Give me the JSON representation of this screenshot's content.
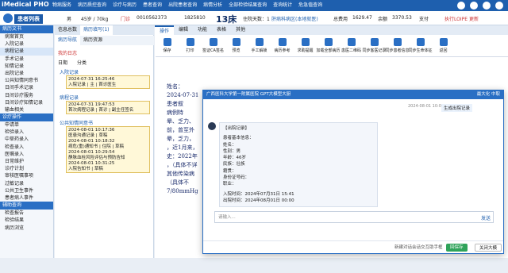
{
  "app": {
    "logo": "iMedical PHO",
    "menu": [
      "物病服务",
      "病历质控查询",
      "诊疗与病历",
      "患者查询",
      "出院患者查询",
      "病情分析",
      "全部检验结果查询",
      "查询统计",
      "危急值查询"
    ]
  },
  "patient": {
    "tag": "患者列表",
    "gender": "男",
    "age_weight": "45岁 / 70kg",
    "flag": "门诊",
    "id": "0010562373",
    "no": "1825810",
    "bed": "13床",
    "days": "住院天数：1",
    "ward": "肝病科病区(本地就医)",
    "cost_label": "总费用",
    "cost": "1629.47",
    "balance_label": "余额",
    "balance": "3370.53",
    "pay": "支付",
    "alert": "执行LOIPE 更新"
  },
  "left": {
    "sections": [
      {
        "title": "病历文书",
        "items": [
          "病案首页",
          "入院记录",
          "病程记录",
          "手术记录",
          "知情记录",
          "出院记录",
          "公共知情同意书",
          "日间手术记录",
          "日间诊疗服务",
          "日间诊疗知情记录",
          "输血相关"
        ]
      },
      {
        "title": "诊疗操作",
        "items": [
          "申请单",
          "检验录入",
          "中草药录入",
          "检查录入",
          "医嘱录入",
          "日常维护",
          "诊疗计划",
          "审核医嘱事项",
          "过敏记录",
          "公共卫生事件",
          "患者病人事件"
        ]
      },
      {
        "title": "辅助查询",
        "items": [
          "检查报告",
          "检验结果",
          "病历浏览"
        ]
      }
    ]
  },
  "tree": {
    "tabs": [
      "信息总数",
      "病历填写(1)"
    ],
    "subtabs": [
      "病历导航",
      "病历资源"
    ],
    "filter": "我的日志",
    "filter2": "日期",
    "filter3": "分类",
    "groups": [
      {
        "title": "入院记录",
        "items": [
          "2024-07-31 16:25:46",
          "入院记录 | 主 | 首诊医生"
        ]
      },
      {
        "title": "病程记录",
        "items": [
          "2024-07-31 19:47:53",
          "首次病程记录 | 首诊 | 副主任签名"
        ]
      },
      {
        "title": "公共知情同意书",
        "items": [
          "2024-08-01 10:17:36",
          "医患沟通记录 | 草稿",
          "2024-08-01 10:18:32",
          "病危(重)通知书 | 住院 | 草稿",
          "2024-08-01 10:29:54",
          "静脉血栓风险评估与预防告知",
          "2024-08-01 10:31:25",
          "入院告知书 | 草稿"
        ]
      }
    ]
  },
  "centerTabs": [
    "操作",
    "编辑",
    "功能",
    "表格",
    "其他"
  ],
  "toolbar": [
    "保存",
    "打印",
    "签证CA签名",
    "预览",
    "手工解锁",
    "病历参考",
    "求助提醒",
    "加载全部病历",
    "患医二维码",
    "同步客医记录",
    "同步患者信息",
    "同步生命体征",
    "返回"
  ],
  "doc": {
    "lines": [
      "姓名：",
      "2024-07-31",
      "患者叙",
      "病例特",
      "晕、乏力、",
      "前，曾至外",
      "晕，乏力，",
      "，近1月来，",
      "史：2022年",
      "，（具体不详",
      "其他传染病",
      "（具体不",
      "7/80mmHg"
    ]
  },
  "dialog": {
    "title": "广西医科大学第一附属医院 GPT大模型大厨",
    "controls": "最大化 中取",
    "user_time": "2024-08-01 10:00",
    "user_msg": "生成出院记录",
    "reply": [
      "【出院记录】",
      "",
      "患者基本信息：",
      "姓名：",
      "性别：男",
      "年龄：46岁",
      "民族：壮族",
      "籍贯：",
      "身份证号码：",
      "职业：",
      "",
      "入院时间：2024年07月31日 15:41",
      "出院时间：2024年08月01日 00:00"
    ],
    "placeholder": "请输入...",
    "send": "发送",
    "new_chat": "新建对话会话交互助手框",
    "save": "回保存",
    "close": "关闭大模"
  }
}
